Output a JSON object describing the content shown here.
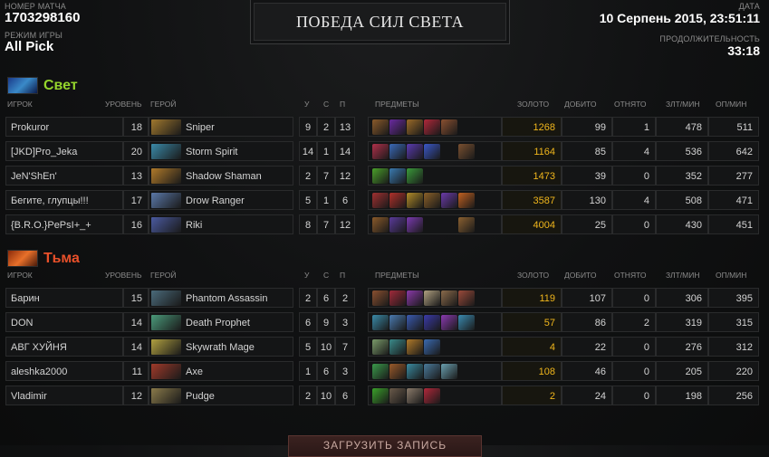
{
  "header": {
    "match_id_label": "НОМЕР МАТЧА",
    "match_id": "1703298160",
    "mode_label": "РЕЖИМ ИГРЫ",
    "mode": "All Pick",
    "victory_text": "ПОБЕДА СИЛ СВЕТА",
    "date_label": "ДАТА",
    "date": "10 Серпень 2015, 23:51:11",
    "duration_label": "ПРОДОЛЖИТЕЛЬНОСТЬ",
    "duration": "33:18"
  },
  "columns": {
    "player": "ИГРОК",
    "level": "УРОВЕНЬ",
    "hero": "ГЕРОЙ",
    "kills": "У",
    "deaths": "С",
    "assists": "П",
    "items": "ПРЕДМЕТЫ",
    "gold": "ЗОЛОТО",
    "last_hits": "ДОБИТО",
    "denies": "ОТНЯТО",
    "gpm": "ЗЛТ/МИН",
    "xpm": "ОП/МИН"
  },
  "radiant": {
    "name": "Свет",
    "color": "#94d42c",
    "icon": "radiant-team-icon",
    "players": [
      {
        "player": "Prokuror",
        "level": "18",
        "hero": "Sniper",
        "hero_color": "#a0782e",
        "k": "9",
        "d": "2",
        "a": "13",
        "items": [
          "#8a5a2a",
          "#6a2aa0",
          "#9a6a28",
          "#b0283a",
          "#8a5030"
        ],
        "gold": "1268",
        "lh": "99",
        "dn": "1",
        "gpm": "478",
        "xpm": "511"
      },
      {
        "player": "[JKD]Pro_Jeka",
        "level": "20",
        "hero": "Storm Spirit",
        "hero_color": "#3a8aa8",
        "k": "14",
        "d": "1",
        "a": "14",
        "items": [
          "#b0304a",
          "#3a6ab8",
          "#5a3ab0",
          "#3a58c8",
          "",
          "#7a5030"
        ],
        "gold": "1164",
        "lh": "85",
        "dn": "4",
        "gpm": "536",
        "xpm": "642"
      },
      {
        "player": "JeN'ShEn'",
        "level": "13",
        "hero": "Shadow Shaman",
        "hero_color": "#b07a2a",
        "k": "2",
        "d": "7",
        "a": "12",
        "items": [
          "#4aa02a",
          "#3a7ab0",
          "#3a9a3a"
        ],
        "gold": "1473",
        "lh": "39",
        "dn": "0",
        "gpm": "352",
        "xpm": "277"
      },
      {
        "player": "Бегите, глупцы!!!",
        "level": "17",
        "hero": "Drow Ranger",
        "hero_color": "#5a78a8",
        "k": "5",
        "d": "1",
        "a": "6",
        "items": [
          "#a03030",
          "#b0302a",
          "#b08a28",
          "#8a6028",
          "#6a3aa8",
          "#c06020"
        ],
        "gold": "3587",
        "lh": "130",
        "dn": "4",
        "gpm": "508",
        "xpm": "471"
      },
      {
        "player": "{B.R.O.}PePsI+_+",
        "level": "16",
        "hero": "Riki",
        "hero_color": "#4a5aa0",
        "k": "8",
        "d": "7",
        "a": "12",
        "items": [
          "#8a5a2a",
          "#5a3a9a",
          "#7a3ab0",
          "",
          "",
          "#8a6030"
        ],
        "gold": "4004",
        "lh": "25",
        "dn": "0",
        "gpm": "430",
        "xpm": "451"
      }
    ]
  },
  "dire": {
    "name": "Тьма",
    "color": "#e8502a",
    "icon": "dire-team-icon",
    "players": [
      {
        "player": "Барин",
        "level": "15",
        "hero": "Phantom Assassin",
        "hero_color": "#4a6a7a",
        "k": "2",
        "d": "6",
        "a": "2",
        "items": [
          "#8a5030",
          "#a02a3a",
          "#8a3aa8",
          "#b0a080",
          "#8a6a4a",
          "#9a4a3a"
        ],
        "gold": "119",
        "lh": "107",
        "dn": "0",
        "gpm": "306",
        "xpm": "395"
      },
      {
        "player": "DON",
        "level": "14",
        "hero": "Death Prophet",
        "hero_color": "#4a9a7a",
        "k": "6",
        "d": "9",
        "a": "3",
        "items": [
          "#3a8aa8",
          "#4a7ab0",
          "#3a5ab0",
          "#3a3aa8",
          "#8a3ab0",
          "#3a8ab0"
        ],
        "gold": "57",
        "lh": "86",
        "dn": "2",
        "gpm": "319",
        "xpm": "315"
      },
      {
        "player": "АВГ ХУЙНЯ",
        "level": "14",
        "hero": "Skywrath Mage",
        "hero_color": "#b0a040",
        "k": "5",
        "d": "10",
        "a": "7",
        "items": [
          "#7a9a6a",
          "#3a8a8a",
          "#b07a2a",
          "#3a6ab0"
        ],
        "gold": "4",
        "lh": "22",
        "dn": "0",
        "gpm": "276",
        "xpm": "312"
      },
      {
        "player": "aleshka2000",
        "level": "11",
        "hero": "Axe",
        "hero_color": "#a03a2a",
        "k": "1",
        "d": "6",
        "a": "3",
        "items": [
          "#3a9a4a",
          "#9a5a2a",
          "#3a8aa0",
          "#4a7a9a",
          "#6aa0b0"
        ],
        "gold": "108",
        "lh": "46",
        "dn": "0",
        "gpm": "205",
        "xpm": "220"
      },
      {
        "player": "Vladimir",
        "level": "12",
        "hero": "Pudge",
        "hero_color": "#8a7a4a",
        "k": "2",
        "d": "10",
        "a": "6",
        "items": [
          "#3aa02a",
          "#6a5a4a",
          "#8a7a6a",
          "#b0283a"
        ],
        "gold": "2",
        "lh": "24",
        "dn": "0",
        "gpm": "198",
        "xpm": "256"
      }
    ]
  },
  "download_button": "ЗАГРУЗИТЬ ЗАПИСЬ"
}
